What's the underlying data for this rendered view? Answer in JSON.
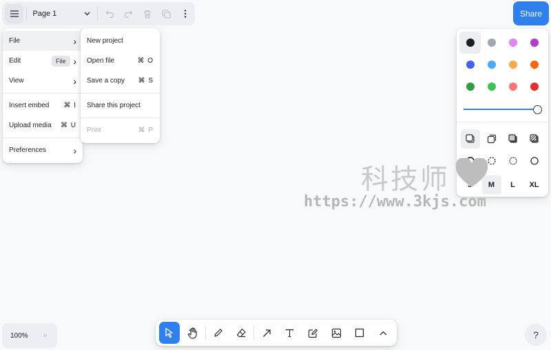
{
  "topbar": {
    "page_label": "Page 1"
  },
  "share_label": "Share",
  "main_menu": {
    "items": [
      {
        "label": "File",
        "arrow": "›"
      },
      {
        "label": "Edit",
        "arrow": "›"
      },
      {
        "label": "View",
        "arrow": "›"
      },
      {
        "label": "Insert embed",
        "shortcut": "⌘ I"
      },
      {
        "label": "Upload media",
        "shortcut": "⌘ U"
      },
      {
        "label": "Preferences",
        "arrow": "›"
      }
    ]
  },
  "tooltip": "File",
  "file_menu": {
    "items": [
      {
        "label": "New project"
      },
      {
        "label": "Open file",
        "shortcut": "⌘ O"
      },
      {
        "label": "Save a copy",
        "shortcut": "⌘ S"
      },
      {
        "label": "Share this project"
      },
      {
        "label": "Print",
        "shortcut": "⌘ P",
        "disabled": true
      }
    ]
  },
  "style_panel": {
    "colors": [
      "#1d1d1d",
      "#9fa8b2",
      "#e085f4",
      "#ae3ec9",
      "#4263eb",
      "#4dabf7",
      "#ffa94d",
      "#f76707",
      "#2f9e44",
      "#40c057",
      "#f87777",
      "#e03131"
    ],
    "opacity": 1.0,
    "sizes": [
      "S",
      "M",
      "L",
      "XL"
    ],
    "selected_size": "M"
  },
  "zoom": {
    "level": "100%",
    "expand": "»"
  },
  "help_label": "?",
  "watermark": {
    "cn": "科技师",
    "url": "https://www.3kjs.com"
  }
}
